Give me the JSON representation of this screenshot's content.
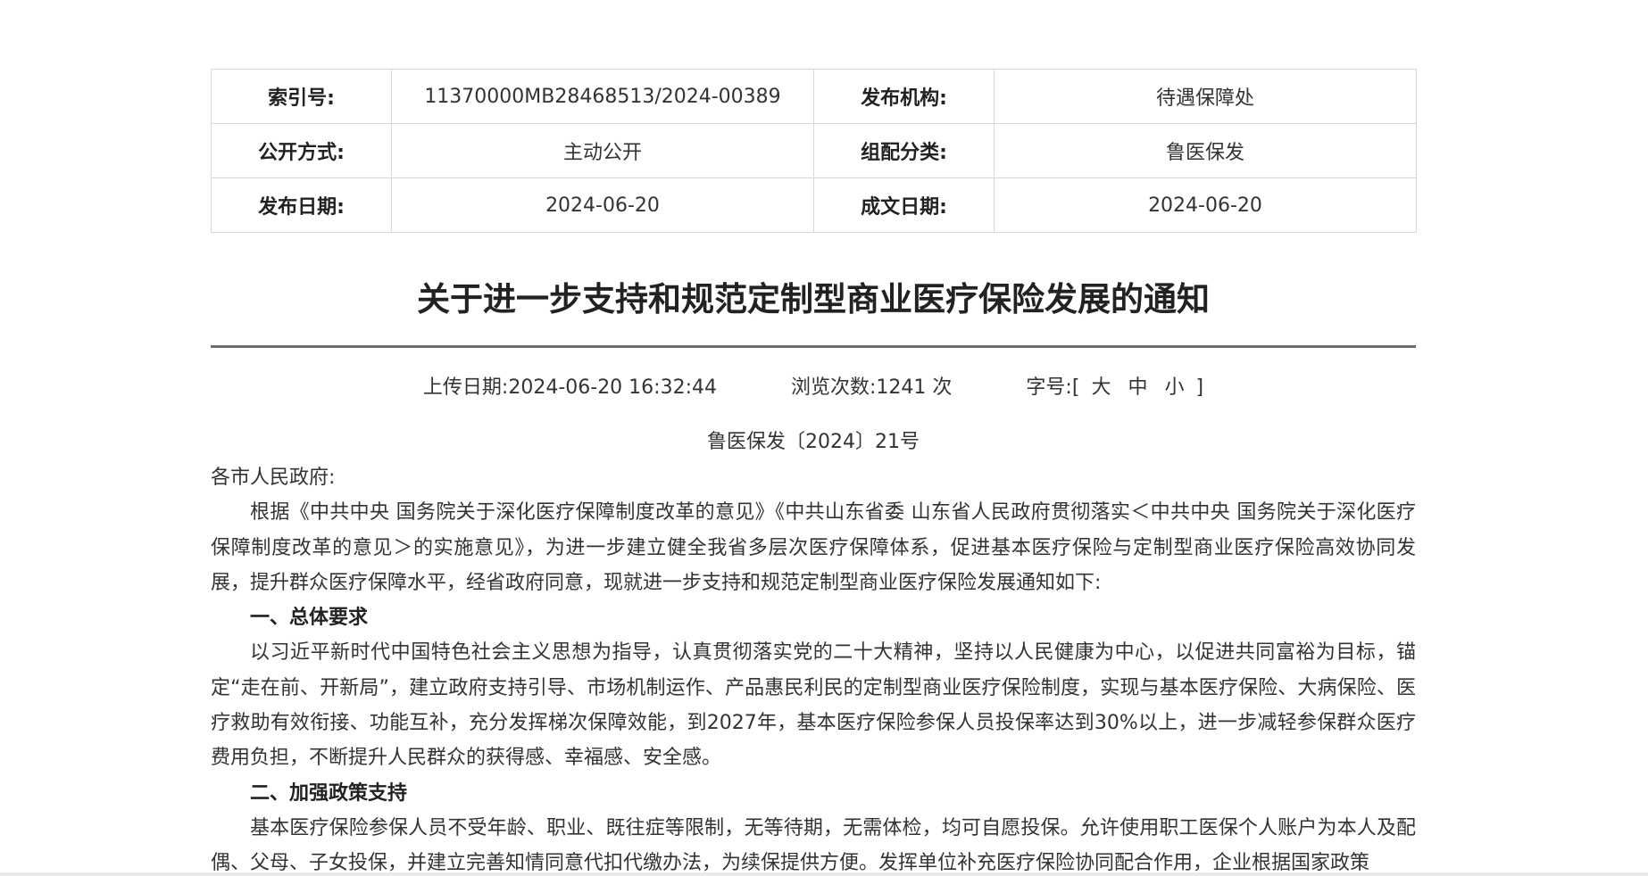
{
  "meta_table": {
    "rows": [
      {
        "k1": "索引号:",
        "v1": "11370000MB28468513/2024-00389",
        "k2": "发布机构:",
        "v2": "待遇保障处"
      },
      {
        "k1": "公开方式:",
        "v1": "主动公开",
        "k2": "组配分类:",
        "v2": "鲁医保发"
      },
      {
        "k1": "发布日期:",
        "v1": "2024-06-20",
        "k2": "成文日期:",
        "v2": "2024-06-20"
      }
    ]
  },
  "article": {
    "title": "关于进一步支持和规范定制型商业医疗保险发展的通知",
    "upload_label": "上传日期:",
    "upload_value": "2024-06-20 16:32:44",
    "views_label": "浏览次数:",
    "views_value": "1241",
    "views_unit": "次",
    "fontsize_label": "字号:",
    "fontsize_open": "[",
    "fontsize_big": "大",
    "fontsize_mid": "中",
    "fontsize_small": "小",
    "fontsize_close": "]",
    "doc_number": "鲁医保发〔2024〕21号",
    "salutation": "各市人民政府:",
    "para1": "根据《中共中央 国务院关于深化医疗保障制度改革的意见》《中共山东省委 山东省人民政府贯彻落实＜中共中央 国务院关于深化医疗保障制度改革的意见＞的实施意见》，为进一步建立健全我省多层次医疗保障体系，促进基本医疗保险与定制型商业医疗保险高效协同发展，提升群众医疗保障水平，经省政府同意，现就进一步支持和规范定制型商业医疗保险发展通知如下:",
    "heading1": "一、总体要求",
    "para2": "以习近平新时代中国特色社会主义思想为指导，认真贯彻落实党的二十大精神，坚持以人民健康为中心，以促进共同富裕为目标，锚定“走在前、开新局”，建立政府支持引导、市场机制运作、产品惠民利民的定制型商业医疗保险制度，实现与基本医疗保险、大病保险、医疗救助有效衔接、功能互补，充分发挥梯次保障效能，到2027年，基本医疗保险参保人员投保率达到30%以上，进一步减轻参保群众医疗费用负担，不断提升人民群众的获得感、幸福感、安全感。",
    "heading2": "二、加强政策支持",
    "para3": "基本医疗保险参保人员不受年龄、职业、既往症等限制，无等待期，无需体检，均可自愿投保。允许使用职工医保个人账户为本人及配偶、父母、子女投保，并建立完善知情同意代扣代缴办法，为续保提供方便。发挥单位补充医疗保险协同配合作用，企业根据国家政策"
  }
}
